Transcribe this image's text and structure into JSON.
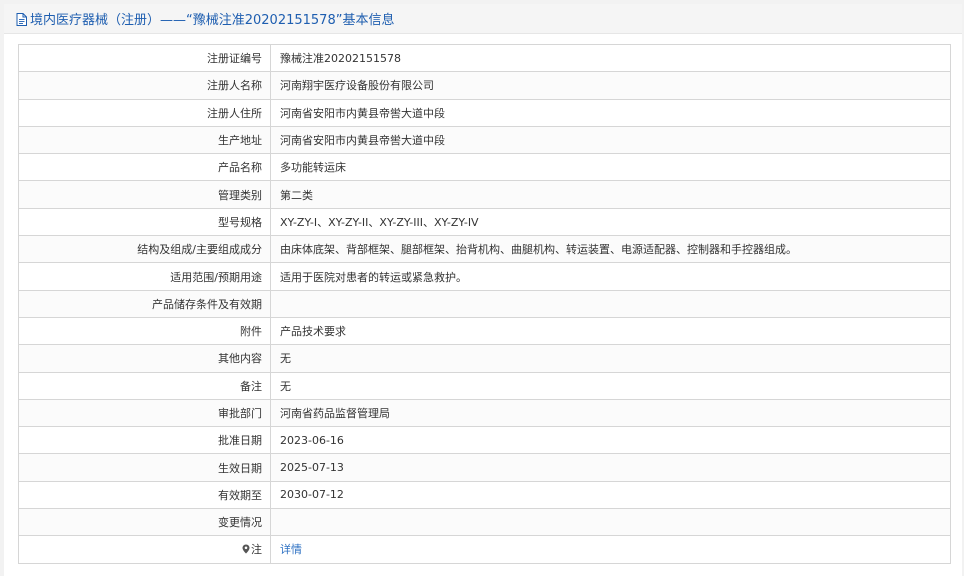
{
  "header": {
    "title": "境内医疗器械（注册）——“豫械注准20202151578”基本信息",
    "icon": "document-icon",
    "accent_color": "#1e5eb0"
  },
  "rows": [
    {
      "label": "注册证编号",
      "value": "豫械注准20202151578"
    },
    {
      "label": "注册人名称",
      "value": "河南翔宇医疗设备股份有限公司"
    },
    {
      "label": "注册人住所",
      "value": "河南省安阳市内黄县帝喾大道中段"
    },
    {
      "label": "生产地址",
      "value": "河南省安阳市内黄县帝喾大道中段"
    },
    {
      "label": "产品名称",
      "value": "多功能转运床"
    },
    {
      "label": "管理类别",
      "value": "第二类"
    },
    {
      "label": "型号规格",
      "value": "XY-ZY-I、XY-ZY-II、XY-ZY-III、XY-ZY-IV"
    },
    {
      "label": "结构及组成/主要组成成分",
      "value": "由床体底架、背部框架、腿部框架、抬背机构、曲腿机构、转运装置、电源适配器、控制器和手控器组成。"
    },
    {
      "label": "适用范围/预期用途",
      "value": "适用于医院对患者的转运或紧急救护。"
    },
    {
      "label": "产品储存条件及有效期",
      "value": ""
    },
    {
      "label": "附件",
      "value": "产品技术要求"
    },
    {
      "label": "其他内容",
      "value": "无"
    },
    {
      "label": "备注",
      "value": "无"
    },
    {
      "label": "审批部门",
      "value": "河南省药品监督管理局"
    },
    {
      "label": "批准日期",
      "value": "2023-06-16"
    },
    {
      "label": "生效日期",
      "value": "2025-07-13"
    },
    {
      "label": "有效期至",
      "value": "2030-07-12"
    },
    {
      "label": "变更情况",
      "value": ""
    }
  ],
  "note": {
    "label": "注",
    "icon": "pin-icon",
    "link_text": "详情",
    "link_color": "#2b6fc2"
  }
}
